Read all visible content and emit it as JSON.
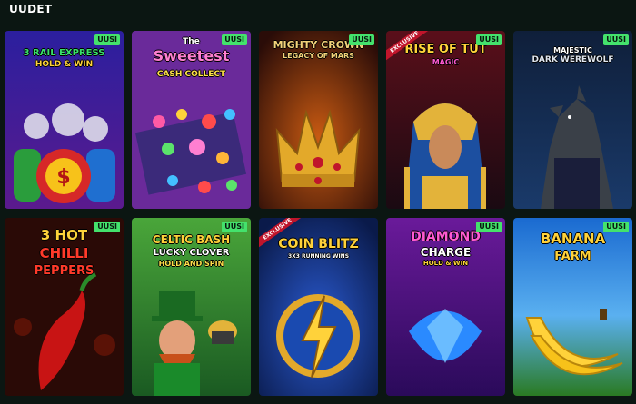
{
  "section": {
    "title": "UUDET"
  },
  "badge_label": "UUSI",
  "exclusive_label": "EXCLUSIVE",
  "games": [
    {
      "lines": [
        "3 RAIL EXPRESS",
        "HOLD & WIN"
      ],
      "new": true,
      "exclusive": false
    },
    {
      "lines": [
        "The",
        "Sweetest",
        "CASH COLLECT"
      ],
      "new": true,
      "exclusive": false
    },
    {
      "lines": [
        "MIGHTY CROWN",
        "LEGACY OF MARS"
      ],
      "new": true,
      "exclusive": false
    },
    {
      "lines": [
        "RISE OF TUT",
        "MAGIC"
      ],
      "new": true,
      "exclusive": true
    },
    {
      "lines": [
        "MAJESTIC",
        "DARK WEREWOLF"
      ],
      "new": true,
      "exclusive": false
    },
    {
      "lines": [
        "3 HOT",
        "CHILLI",
        "PEPPERS"
      ],
      "new": true,
      "exclusive": false
    },
    {
      "lines": [
        "CELTIC BASH",
        "LUCKY CLOVER",
        "HOLD AND SPIN"
      ],
      "new": true,
      "exclusive": false
    },
    {
      "lines": [
        "COIN BLITZ",
        "3X3 RUNNING WINS"
      ],
      "new": false,
      "exclusive": true
    },
    {
      "lines": [
        "DIAMOND",
        "CHARGE",
        "HOLD & WIN"
      ],
      "new": true,
      "exclusive": false
    },
    {
      "lines": [
        "BANANA",
        "FARM"
      ],
      "new": true,
      "exclusive": false
    }
  ]
}
